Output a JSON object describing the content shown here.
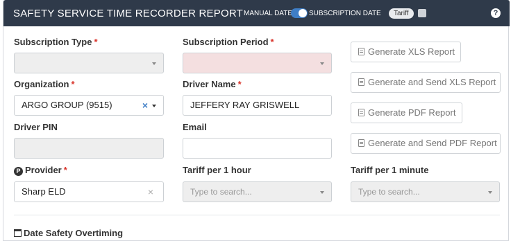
{
  "header": {
    "title": "SAFETY SERVICE TIME RECORDER REPORT",
    "manual_date": "MANUAL DATE",
    "subscription_date": "SUBSCRIPTION DATE",
    "tariff_badge": "Tariff",
    "help": "?"
  },
  "form": {
    "subscription_type": {
      "label": "Subscription Type",
      "required": "*",
      "value": ""
    },
    "subscription_period": {
      "label": "Subscription Period",
      "required": "*",
      "value": ""
    },
    "organization": {
      "label": "Organization",
      "required": "*",
      "value": "ARGO GROUP (9515)",
      "clear": "×"
    },
    "driver_name": {
      "label": "Driver Name",
      "required": "*",
      "value": "JEFFERY RAY GRISWELL"
    },
    "driver_pin": {
      "label": "Driver PIN",
      "value": ""
    },
    "email": {
      "label": "Email",
      "value": ""
    },
    "provider": {
      "label": "Provider",
      "required": "*",
      "icon_text": "P",
      "value": "Sharp ELD",
      "clear": "×"
    },
    "tariff_hour": {
      "label": "Tariff per 1 hour",
      "placeholder": "Type to search..."
    },
    "tariff_minute": {
      "label": "Tariff per 1 minute",
      "placeholder": "Type to search..."
    }
  },
  "buttons": {
    "xls": "Generate XLS Report",
    "xls_send": "Generate and Send XLS Report",
    "pdf": "Generate PDF Report",
    "pdf_send": "Generate and Send PDF Report"
  },
  "section": {
    "date_title": "Date Safety Overtiming"
  },
  "icons": {
    "help": "question-circle-icon",
    "file_excel": "file-excel-icon",
    "file_pdf": "file-pdf-icon",
    "calendar": "calendar-icon",
    "provider": "provider-p-icon",
    "caret": "caret-down-icon"
  },
  "colors": {
    "header_bg": "#2f3a4a",
    "required": "#d9342b",
    "toggle_on": "#3f7ec6",
    "invalid_field": "#f4dfe0"
  },
  "state": {
    "date_toggle": "subscription date",
    "tariff_checked": false
  }
}
